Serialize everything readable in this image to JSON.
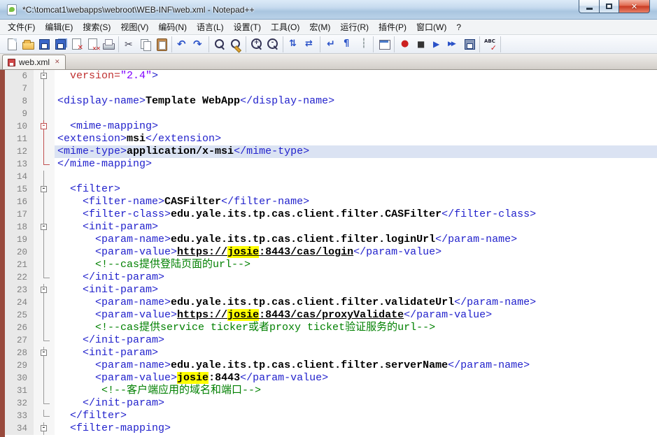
{
  "window": {
    "title": "*C:\\tomcat1\\webapps\\webroot\\WEB-INF\\web.xml - Notepad++",
    "controls": [
      "minimize-icon",
      "maximize-icon",
      "close-icon"
    ]
  },
  "menu": {
    "items": [
      "文件(F)",
      "编辑(E)",
      "搜索(S)",
      "视图(V)",
      "编码(N)",
      "语言(L)",
      "设置(T)",
      "工具(O)",
      "宏(M)",
      "运行(R)",
      "插件(P)",
      "窗口(W)",
      "?"
    ]
  },
  "toolbar": {
    "groups": [
      [
        "new-file",
        "open",
        "save",
        "save-all",
        "close",
        "close-all",
        "print"
      ],
      [
        "cut",
        "copy",
        "paste"
      ],
      [
        "undo",
        "redo"
      ],
      [
        "find",
        "replace"
      ],
      [
        "zoom-in",
        "zoom-out"
      ],
      [
        "sync-scroll-vertical",
        "sync-scroll-horizontal"
      ],
      [
        "word-wrap",
        "show-all-characters",
        "indent-guide"
      ],
      [
        "user-defined-dialog"
      ],
      [
        "record-macro",
        "stop-macro",
        "playback-macro",
        "run-macro-multiple",
        "save-macro"
      ],
      [
        "spell-check"
      ]
    ]
  },
  "tabs": [
    {
      "label": "web.xml",
      "modified": true,
      "active": true
    }
  ],
  "editor": {
    "colors": {
      "tag": "#2222cc",
      "attr": "#c03030",
      "val": "#8000ff",
      "txt": "#000000",
      "com": "#008000",
      "hl_bg": "#ffff00",
      "sel_bg": "#dbe3f3",
      "url": "#000000"
    },
    "selected_line": 12,
    "highlighted_word": "josie",
    "lines": [
      {
        "n": 6,
        "ind": 2,
        "f": "box",
        "seg": [
          [
            "version=",
            "attr"
          ],
          [
            "\"2.4\"",
            "val"
          ],
          [
            ">",
            "tag"
          ]
        ]
      },
      {
        "n": 7,
        "ind": 0,
        "f": "vline",
        "seg": []
      },
      {
        "n": 8,
        "ind": 0,
        "f": "vline",
        "seg": [
          [
            "<display-name>",
            "tag"
          ],
          [
            "Template WebApp",
            "txt"
          ],
          [
            "</display-name>",
            "tag"
          ]
        ]
      },
      {
        "n": 9,
        "ind": 0,
        "f": "vline",
        "seg": []
      },
      {
        "n": 10,
        "ind": 2,
        "f": "box",
        "r": true,
        "seg": [
          [
            "<mime-mapping>",
            "tag"
          ]
        ]
      },
      {
        "n": 11,
        "ind": 0,
        "f": "vline",
        "r": true,
        "seg": [
          [
            "<extension>",
            "tag"
          ],
          [
            "msi",
            "txt"
          ],
          [
            "</extension>",
            "tag"
          ]
        ]
      },
      {
        "n": 12,
        "ind": 0,
        "f": "vline",
        "r": true,
        "s": true,
        "seg": [
          [
            "<mime-type>",
            "tag"
          ],
          [
            "application/x-msi",
            "txt"
          ],
          [
            "</mime-type>",
            "tag"
          ]
        ]
      },
      {
        "n": 13,
        "ind": 0,
        "f": "end",
        "r": true,
        "seg": [
          [
            "</mime-mapping>",
            "tag"
          ]
        ]
      },
      {
        "n": 14,
        "ind": 0,
        "f": "vline",
        "seg": []
      },
      {
        "n": 15,
        "ind": 2,
        "f": "box",
        "seg": [
          [
            "<filter>",
            "tag"
          ]
        ]
      },
      {
        "n": 16,
        "ind": 4,
        "f": "vline",
        "seg": [
          [
            "<filter-name>",
            "tag"
          ],
          [
            "CASFilter",
            "txt"
          ],
          [
            "</filter-name>",
            "tag"
          ]
        ]
      },
      {
        "n": 17,
        "ind": 4,
        "f": "vline",
        "seg": [
          [
            "<filter-class>",
            "tag"
          ],
          [
            "edu.yale.its.tp.cas.client.filter.CASFilter",
            "txt"
          ],
          [
            "</filter-class>",
            "tag"
          ]
        ]
      },
      {
        "n": 18,
        "ind": 4,
        "f": "box",
        "seg": [
          [
            "<init-param>",
            "tag"
          ]
        ]
      },
      {
        "n": 19,
        "ind": 6,
        "f": "vline",
        "seg": [
          [
            "<param-name>",
            "tag"
          ],
          [
            "edu.yale.its.tp.cas.client.filter.loginUrl",
            "txt"
          ],
          [
            "</param-name>",
            "tag"
          ]
        ]
      },
      {
        "n": 20,
        "ind": 6,
        "f": "vline",
        "seg": [
          [
            "<param-value>",
            "tag"
          ],
          [
            "https://",
            "url"
          ],
          [
            "josie",
            "hlu"
          ],
          [
            ":8443/cas/login",
            "url"
          ],
          [
            "</param-value>",
            "tag"
          ]
        ]
      },
      {
        "n": 21,
        "ind": 6,
        "f": "vline",
        "seg": [
          [
            "<!--cas提供登陆页面的url-->",
            "com"
          ]
        ]
      },
      {
        "n": 22,
        "ind": 4,
        "f": "end",
        "seg": [
          [
            "</init-param>",
            "tag"
          ]
        ]
      },
      {
        "n": 23,
        "ind": 4,
        "f": "box",
        "seg": [
          [
            "<init-param>",
            "tag"
          ]
        ]
      },
      {
        "n": 24,
        "ind": 6,
        "f": "vline",
        "seg": [
          [
            "<param-name>",
            "tag"
          ],
          [
            "edu.yale.its.tp.cas.client.filter.validateUrl",
            "txt"
          ],
          [
            "</param-name>",
            "tag"
          ]
        ]
      },
      {
        "n": 25,
        "ind": 6,
        "f": "vline",
        "seg": [
          [
            "<param-value>",
            "tag"
          ],
          [
            "https://",
            "url"
          ],
          [
            "josie",
            "hlu"
          ],
          [
            ":8443/cas/proxyValidate",
            "url"
          ],
          [
            "</param-value>",
            "tag"
          ]
        ]
      },
      {
        "n": 26,
        "ind": 6,
        "f": "vline",
        "seg": [
          [
            "<!--cas提供service ticker或者proxy ticket验证服务的url-->",
            "com"
          ]
        ]
      },
      {
        "n": 27,
        "ind": 4,
        "f": "end",
        "seg": [
          [
            "</init-param>",
            "tag"
          ]
        ]
      },
      {
        "n": 28,
        "ind": 4,
        "f": "box",
        "seg": [
          [
            "<init-param>",
            "tag"
          ]
        ]
      },
      {
        "n": 29,
        "ind": 6,
        "f": "vline",
        "seg": [
          [
            "<param-name>",
            "tag"
          ],
          [
            "edu.yale.its.tp.cas.client.filter.serverName",
            "txt"
          ],
          [
            "</param-name>",
            "tag"
          ]
        ]
      },
      {
        "n": 30,
        "ind": 6,
        "f": "vline",
        "seg": [
          [
            "<param-value>",
            "tag"
          ],
          [
            "josie",
            "hl"
          ],
          [
            ":8443",
            "txt"
          ],
          [
            "</param-value>",
            "tag"
          ]
        ]
      },
      {
        "n": 31,
        "ind": 7,
        "f": "vline",
        "seg": [
          [
            "<!--客户端应用的域名和端口-->",
            "com"
          ]
        ]
      },
      {
        "n": 32,
        "ind": 4,
        "f": "end",
        "seg": [
          [
            "</init-param>",
            "tag"
          ]
        ]
      },
      {
        "n": 33,
        "ind": 2,
        "f": "end",
        "seg": [
          [
            "</filter>",
            "tag"
          ]
        ]
      },
      {
        "n": 34,
        "ind": 2,
        "f": "box",
        "seg": [
          [
            "<filter-mapping>",
            "tag"
          ]
        ]
      }
    ]
  }
}
